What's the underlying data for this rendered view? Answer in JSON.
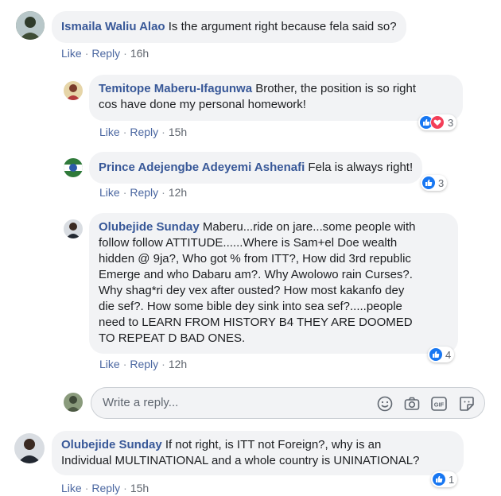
{
  "comments": [
    {
      "author": "Ismaila Waliu Alao",
      "text": "Is the argument right because fela said so?",
      "like": "Like",
      "reply": "Reply",
      "time": "16h"
    },
    {
      "author": "Temitope Maberu-Ifagunwa",
      "text_line1": "Brother, the position is so right",
      "text_line2": "cos have done my personal homework!",
      "like": "Like",
      "reply": "Reply",
      "time": "15h",
      "reactions": "3"
    },
    {
      "author": "Prince Adejengbe Adeyemi Ashenafi",
      "text": "Fela is always right!",
      "like": "Like",
      "reply": "Reply",
      "time": "12h",
      "reactions": "3"
    },
    {
      "author": "Olubejide Sunday",
      "lines": [
        "Maberu...ride on jare...some people with",
        "follow follow ATTITUDE......Where is Sam+el Doe wealth",
        "hidden @ 9ja?, Who got % from ITT?, How did 3rd republic",
        "Emerge and who Dabaru am?. Why Awolowo rain Curses?.",
        "Why shag*ri dey vex after ousted? How most kakanfo dey",
        "die sef?. How some bible dey sink into sea sef?.....people",
        "need to LEARN FROM HISTORY B4 THEY ARE DOOMED",
        "TO REPEAT D BAD ONES."
      ],
      "like": "Like",
      "reply": "Reply",
      "time": "12h",
      "reactions": "4"
    },
    {
      "author": "Olubejide Sunday",
      "text_line1": "If not right, is ITT not Foreign?, why is an",
      "text_line2": "Individual MULTINATIONAL and a whole country is UNINATIONAL?",
      "like": "Like",
      "reply": "Reply",
      "time": "15h",
      "reactions": "1"
    }
  ],
  "reply_box": {
    "placeholder": "Write a reply..."
  },
  "icons": {
    "emoji": "smiley-icon",
    "camera": "camera-icon",
    "gif": "GIF",
    "sticker": "sticker-icon"
  },
  "colors": {
    "author": "#385898",
    "link": "#4b67a1",
    "bubble": "#f2f3f5",
    "like": "#1877f2",
    "love": "#f33e58"
  }
}
